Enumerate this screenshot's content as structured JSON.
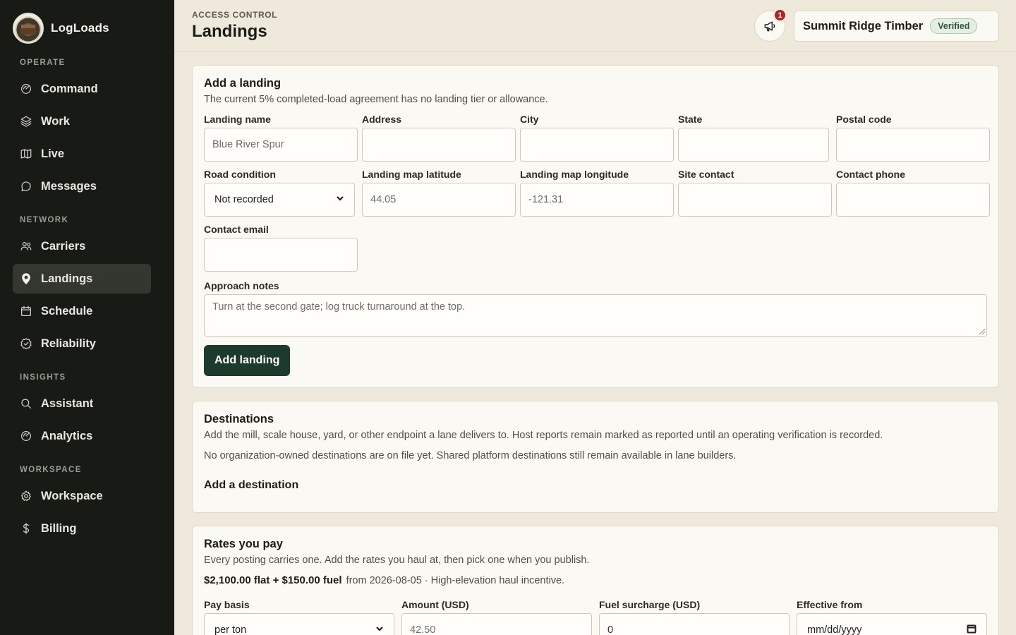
{
  "brand": {
    "name": "LogLoads",
    "logo_icon": "truck-logo-icon"
  },
  "sidebar": {
    "sections": [
      {
        "label": "OPERATE",
        "items": [
          {
            "label": "Command",
            "icon": "radar-icon"
          },
          {
            "label": "Work",
            "icon": "layers-icon"
          },
          {
            "label": "Live",
            "icon": "map-icon"
          },
          {
            "label": "Messages",
            "icon": "chat-icon"
          }
        ]
      },
      {
        "label": "NETWORK",
        "items": [
          {
            "label": "Carriers",
            "icon": "people-icon"
          },
          {
            "label": "Landings",
            "icon": "pin-icon",
            "active": true
          },
          {
            "label": "Schedule",
            "icon": "calendar-icon"
          },
          {
            "label": "Reliability",
            "icon": "badge-check-icon"
          }
        ]
      },
      {
        "label": "INSIGHTS",
        "items": [
          {
            "label": "Assistant",
            "icon": "search-icon"
          },
          {
            "label": "Analytics",
            "icon": "radar-icon"
          }
        ]
      },
      {
        "label": "WORKSPACE",
        "items": [
          {
            "label": "Workspace",
            "icon": "gear-icon"
          },
          {
            "label": "Billing",
            "icon": "dollar-icon"
          }
        ]
      }
    ]
  },
  "header": {
    "eyebrow": "ACCESS CONTROL",
    "title": "Landings",
    "notification_count": "1",
    "org_name": "Summit Ridge Timber",
    "org_status": "Verified"
  },
  "add_landing": {
    "title": "Add a landing",
    "description": "The current 5% completed-load agreement has no landing tier or allowance.",
    "fields": {
      "landing_name": {
        "label": "Landing name",
        "placeholder": "Blue River Spur"
      },
      "address": {
        "label": "Address",
        "placeholder": ""
      },
      "city": {
        "label": "City",
        "placeholder": ""
      },
      "state": {
        "label": "State",
        "placeholder": ""
      },
      "postal_code": {
        "label": "Postal code",
        "placeholder": ""
      },
      "road_condition": {
        "label": "Road condition",
        "value": "Not recorded"
      },
      "latitude": {
        "label": "Landing map latitude",
        "placeholder": "44.05"
      },
      "longitude": {
        "label": "Landing map longitude",
        "placeholder": "-121.31"
      },
      "site_contact": {
        "label": "Site contact",
        "placeholder": ""
      },
      "contact_phone": {
        "label": "Contact phone",
        "placeholder": ""
      },
      "contact_email": {
        "label": "Contact email",
        "placeholder": ""
      },
      "approach_notes": {
        "label": "Approach notes",
        "placeholder": "Turn at the second gate; log truck turnaround at the top."
      }
    },
    "submit_label": "Add landing"
  },
  "destinations": {
    "title": "Destinations",
    "description": "Add the mill, scale house, yard, or other endpoint a lane delivers to. Host reports remain marked as reported until an operating verification is recorded.",
    "empty_note": "No organization-owned destinations are on file yet. Shared platform destinations still remain available in lane builders.",
    "add_heading": "Add a destination"
  },
  "rates": {
    "title": "Rates you pay",
    "description": "Every posting carries one. Add the rates you haul at, then pick one when you publish.",
    "current_rate": "$2,100.00 flat + $150.00 fuel",
    "current_rate_meta": "from 2026-08-05 · High-elevation haul incentive.",
    "fields": {
      "pay_basis": {
        "label": "Pay basis",
        "value": "per ton"
      },
      "amount": {
        "label": "Amount (USD)",
        "placeholder": "42.50"
      },
      "fuel_surcharge": {
        "label": "Fuel surcharge (USD)",
        "value": "0"
      },
      "effective_from": {
        "label": "Effective from",
        "value": "mm/dd/yyyy"
      }
    }
  }
}
